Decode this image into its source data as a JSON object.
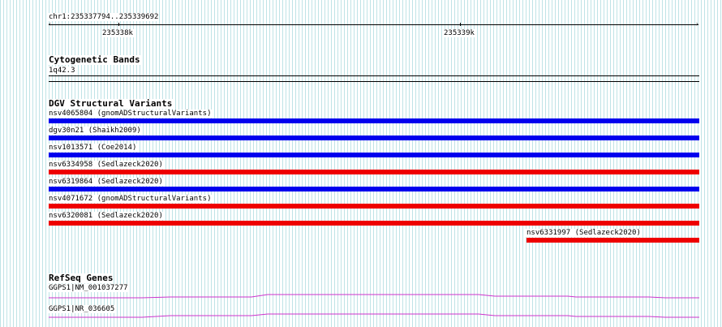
{
  "ruler": {
    "location": "chr1:235337794..235339692",
    "ticks": [
      {
        "label": "235338k"
      },
      {
        "label": "235339k"
      }
    ]
  },
  "cytoband": {
    "title": "Cytogenetic Bands",
    "band": "1q42.3"
  },
  "dgv": {
    "title": "DGV Structural Variants",
    "colors": {
      "blue": "#0000ee",
      "red": "#ee0000"
    },
    "variants": [
      {
        "label": "nsv4065804 (gnomADStructuralVariants)",
        "color": "blue"
      },
      {
        "label": "dgv30n21 (Shaikh2009)",
        "color": "blue"
      },
      {
        "label": "nsv1013571 (Coe2014)",
        "color": "blue"
      },
      {
        "label": "nsv6334958 (Sedlazeck2020)",
        "color": "red"
      },
      {
        "label": "nsv6319864 (Sedlazeck2020)",
        "color": "blue"
      },
      {
        "label": "nsv4071672 (gnomADStructuralVariants)",
        "color": "red"
      },
      {
        "label": "nsv6320081 (Sedlazeck2020)",
        "color": "red"
      },
      {
        "label": "nsv6331997 (Sedlazeck2020)",
        "color": "red"
      }
    ]
  },
  "refseq": {
    "title": "RefSeq Genes",
    "color": "#cc33cc",
    "genes": [
      {
        "label": "GGPS1|NM_001037277"
      },
      {
        "label": "GGPS1|NR_036605"
      }
    ]
  }
}
